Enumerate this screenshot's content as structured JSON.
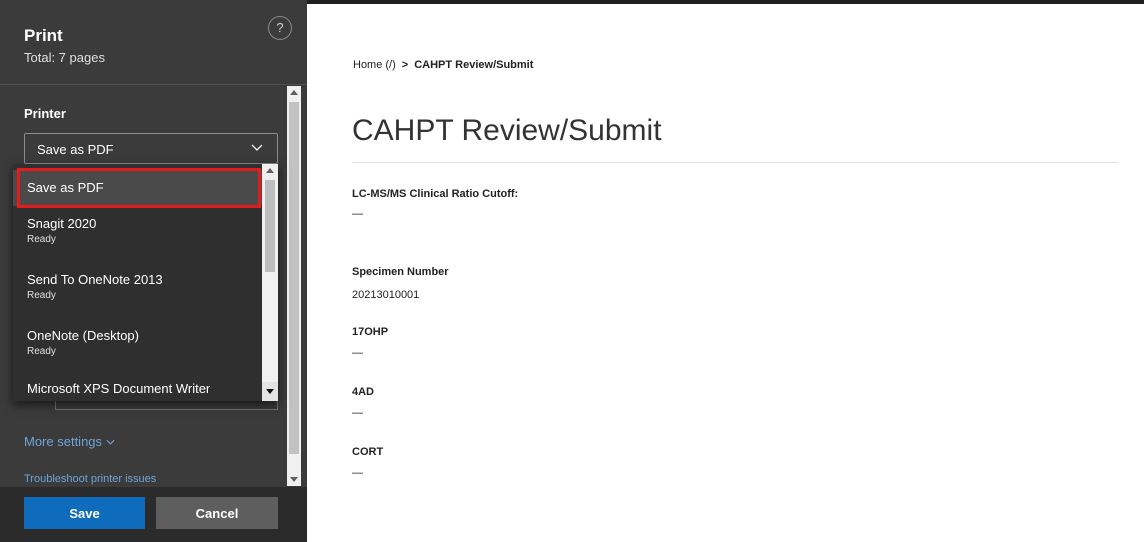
{
  "print_panel": {
    "title": "Print",
    "total_pages": "Total: 7 pages",
    "help_icon": "?",
    "printer_label": "Printer",
    "printer_selected": "Save as PDF",
    "more_settings": "More settings",
    "troubleshoot": "Troubleshoot printer issues",
    "save_label": "Save",
    "cancel_label": "Cancel"
  },
  "printer_dropdown": {
    "items": [
      {
        "name": "Save as PDF",
        "status": "",
        "selected": true
      },
      {
        "name": "Snagit 2020",
        "status": "Ready"
      },
      {
        "name": "Send To OneNote 2013",
        "status": "Ready"
      },
      {
        "name": "OneNote (Desktop)",
        "status": "Ready"
      },
      {
        "name": "Microsoft XPS Document Writer",
        "status": ""
      }
    ]
  },
  "page": {
    "breadcrumb": {
      "home": "Home (/)",
      "separator": ">",
      "current": "CAHPT Review/Submit"
    },
    "title": "CAHPT Review/Submit",
    "fields": [
      {
        "label": "LC-MS/MS Clinical Ratio Cutoff:",
        "value": "—"
      },
      {
        "label": "Specimen Number",
        "value": "20213010001"
      },
      {
        "label": "17OHP",
        "value": "—"
      },
      {
        "label": "4AD",
        "value": "—"
      },
      {
        "label": "CORT",
        "value": "—"
      }
    ]
  },
  "colors": {
    "panel_bg": "#3b3b3b",
    "footer_bg": "#2b2b2b",
    "save_button": "#0f6cbd",
    "link": "#6ea4d8",
    "highlight_box": "#e31b1b"
  },
  "icons": [
    "help-icon",
    "chevron-down-icon",
    "scroll-up-arrow-icon",
    "scroll-down-arrow-icon"
  ]
}
